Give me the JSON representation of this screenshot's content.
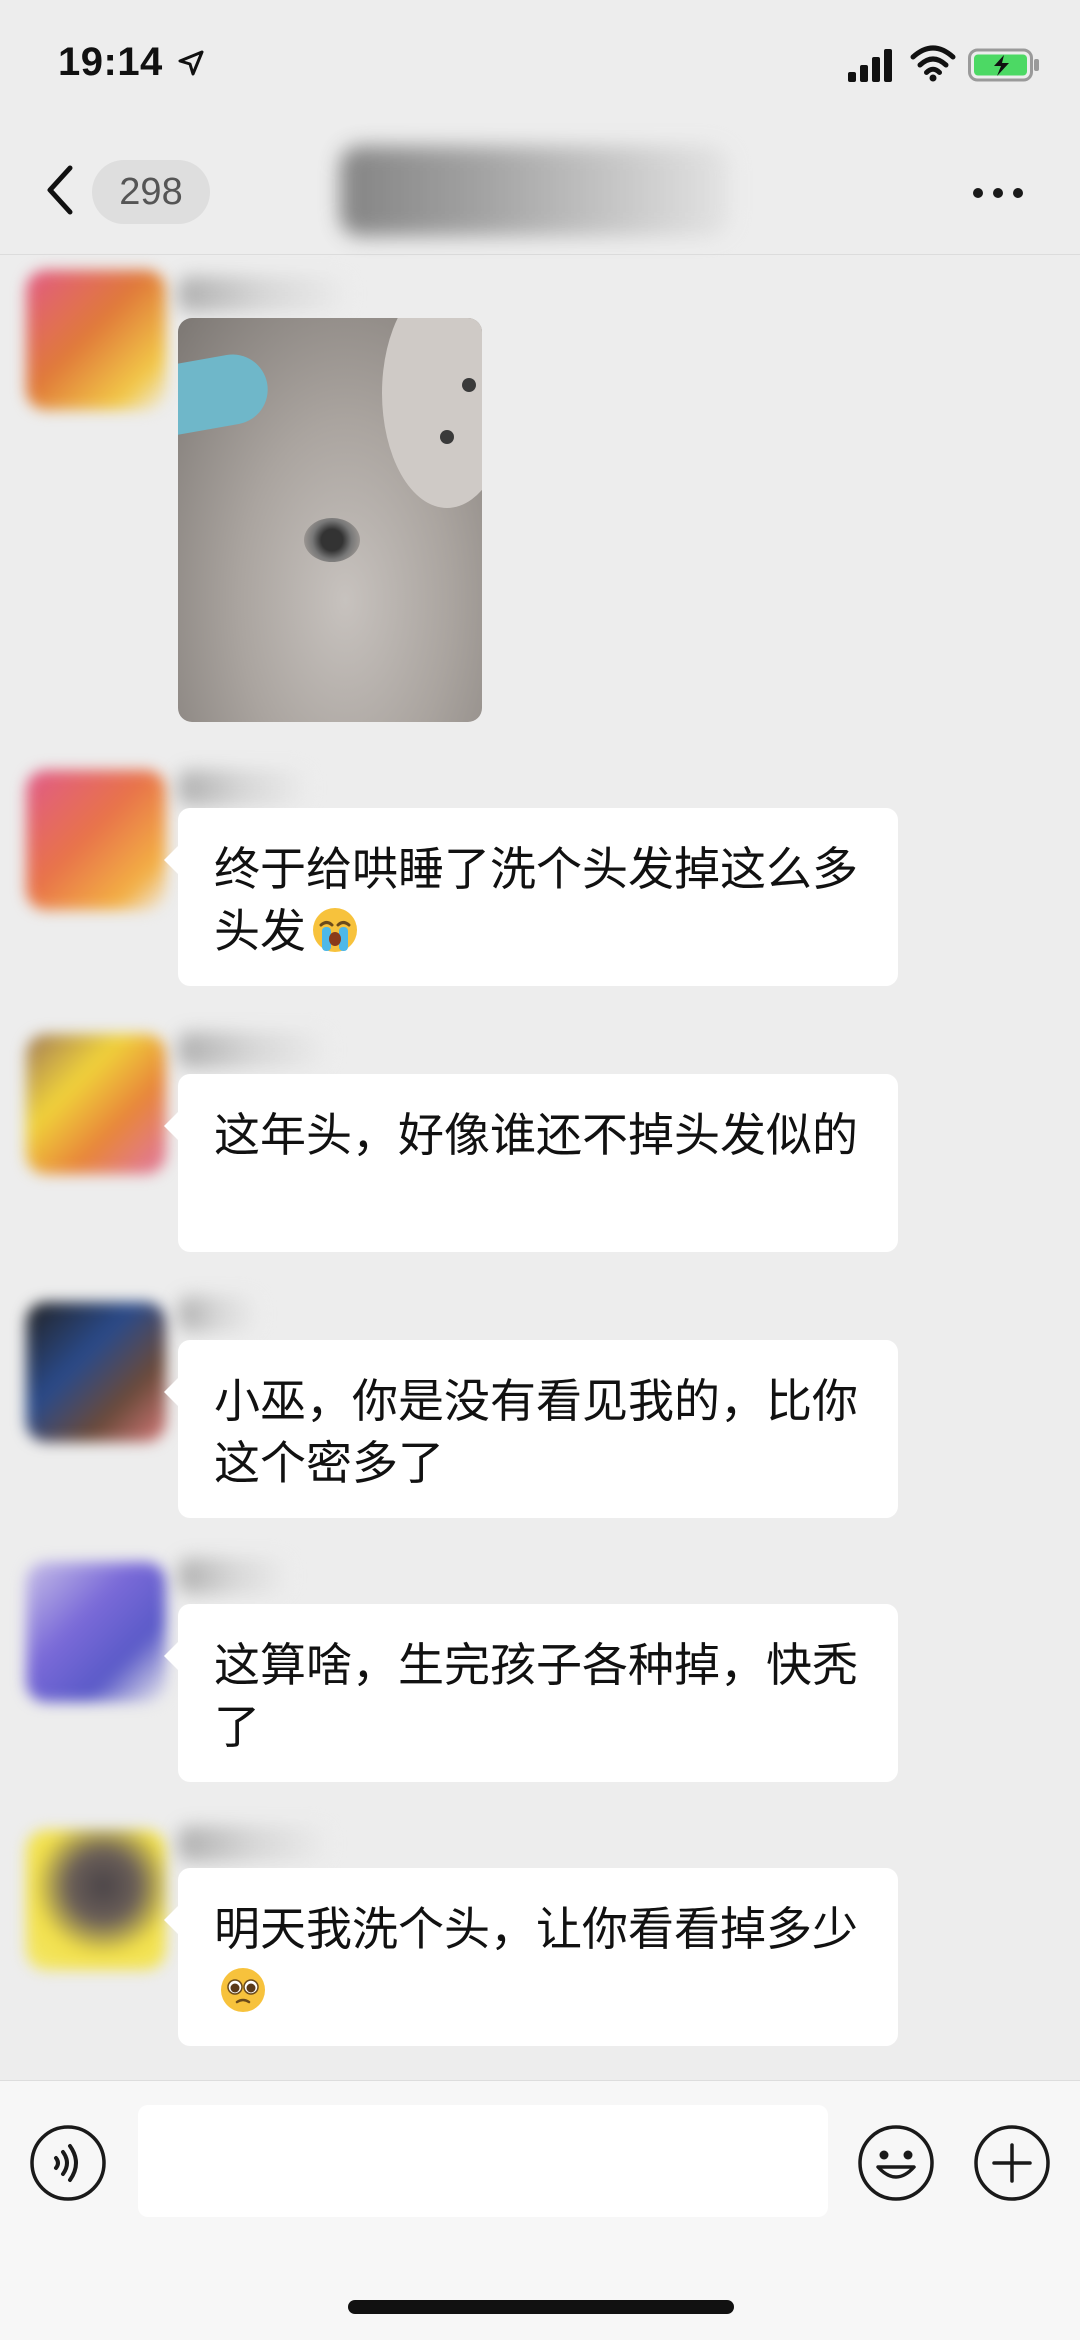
{
  "status_bar": {
    "time": "19:14"
  },
  "nav": {
    "unread_count": "298"
  },
  "messages": [
    {
      "type": "image"
    },
    {
      "type": "text",
      "text": "终于给哄睡了洗个头发掉这么多头发",
      "trailing_emoji": "loudly-crying-face"
    },
    {
      "type": "text",
      "text": "这年头，好像谁还不掉头发似的"
    },
    {
      "type": "text",
      "text": "小巫，你是没有看见我的，比你这个密多了"
    },
    {
      "type": "text",
      "text": "这算啥，生完孩子各种掉，快秃了"
    },
    {
      "type": "text",
      "text": "明天我洗个头，让你看看掉多少",
      "trailing_emoji": "pleading-face"
    }
  ],
  "input_bar": {
    "value": ""
  },
  "icons": {
    "back": "chevron-left-icon",
    "more": "more-dots-icon",
    "voice": "voice-icon",
    "emoji": "emoji-icon",
    "plus": "plus-icon"
  },
  "colors": {
    "background": "#ededed",
    "bubble": "#ffffff",
    "battery_fill": "#4cd964"
  }
}
